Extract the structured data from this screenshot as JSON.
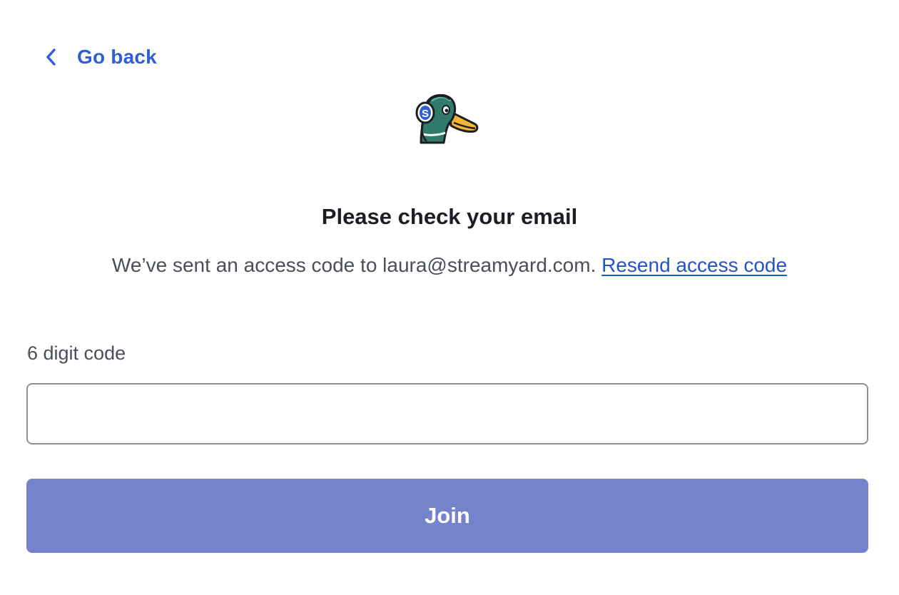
{
  "nav": {
    "back_label": "Go back",
    "back_icon": "chevron-left-icon"
  },
  "logo": {
    "icon": "streamyard-duck-logo",
    "badge_letter": "S"
  },
  "heading": {
    "title": "Please check your email",
    "message": "We’ve sent an access code to laura@streamyard.com.",
    "resend_label": "Resend access code"
  },
  "form": {
    "code_label": "6 digit code",
    "code_value": "",
    "code_placeholder": "",
    "submit_label": "Join"
  },
  "colors": {
    "link": "#2f5fd1",
    "button": "#7583cb",
    "text": "#1c1e23",
    "muted_text": "#4a4f57"
  }
}
